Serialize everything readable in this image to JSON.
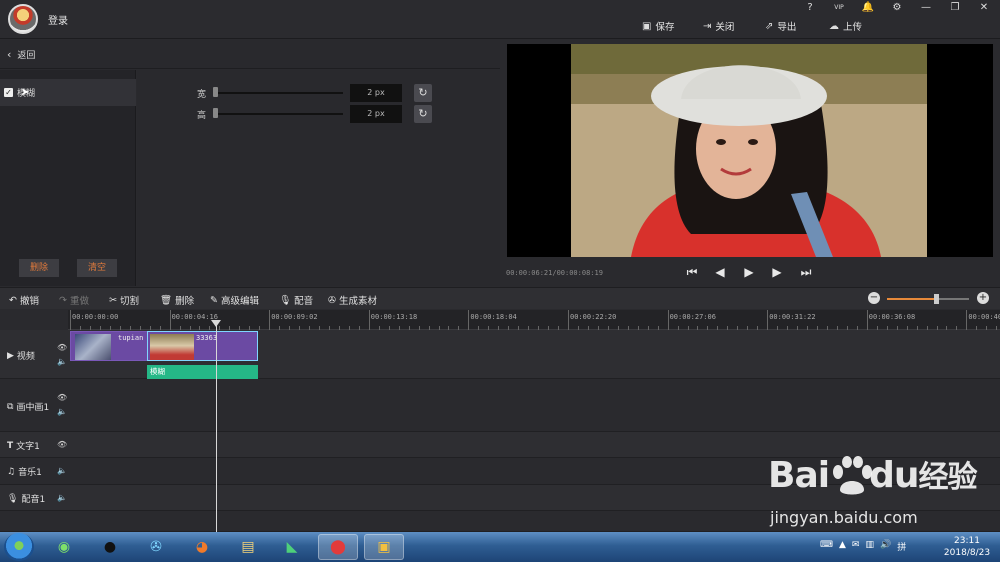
{
  "app": {
    "login_label": "登录",
    "window_controls": {
      "help": "?",
      "vip": "VIP",
      "bell": "🔔",
      "settings": "⚙",
      "minimize": "—",
      "restore": "❐",
      "close": "✕"
    },
    "actions": {
      "save": "保存",
      "close": "关闭",
      "export": "导出",
      "upload": "上传"
    }
  },
  "filter_panel": {
    "back_label": "返回",
    "item_label": "模糊",
    "item_checked": true,
    "delete_label": "删除",
    "clear_label": "清空",
    "params": [
      {
        "label": "宽",
        "value": "2 px"
      },
      {
        "label": "高",
        "value": "2 px"
      }
    ]
  },
  "preview": {
    "timecode": "00:00:06:21/00:00:08:19"
  },
  "toolbar": {
    "undo": "撤销",
    "redo": "重做",
    "cut": "切割",
    "delete": "删除",
    "advanced_edit": "高级编辑",
    "dub": "配音",
    "generate": "生成素材",
    "zoom_level": 0.6
  },
  "ruler": {
    "ticks": [
      "00:00:00:00",
      "00:00:04:16",
      "00:00:09:02",
      "00:00:13:18",
      "00:00:18:04",
      "00:00:22:20",
      "00:00:27:06",
      "00:00:31:22",
      "00:00:36:08",
      "00:00:40:"
    ]
  },
  "tracks": {
    "video": "视频",
    "pip": "画中画1",
    "text": "文字1",
    "music": "音乐1",
    "voice": "配音1",
    "clip1_label": "tupian",
    "clip2_label": "33363",
    "effect_label": "模糊"
  },
  "taskbar": {
    "time": "23:11",
    "date": "2018/8/23"
  },
  "watermark": {
    "logo": "Bai",
    "logo_suffix": "经验",
    "logo_du": "du",
    "url": "jingyan.baidu.com"
  }
}
